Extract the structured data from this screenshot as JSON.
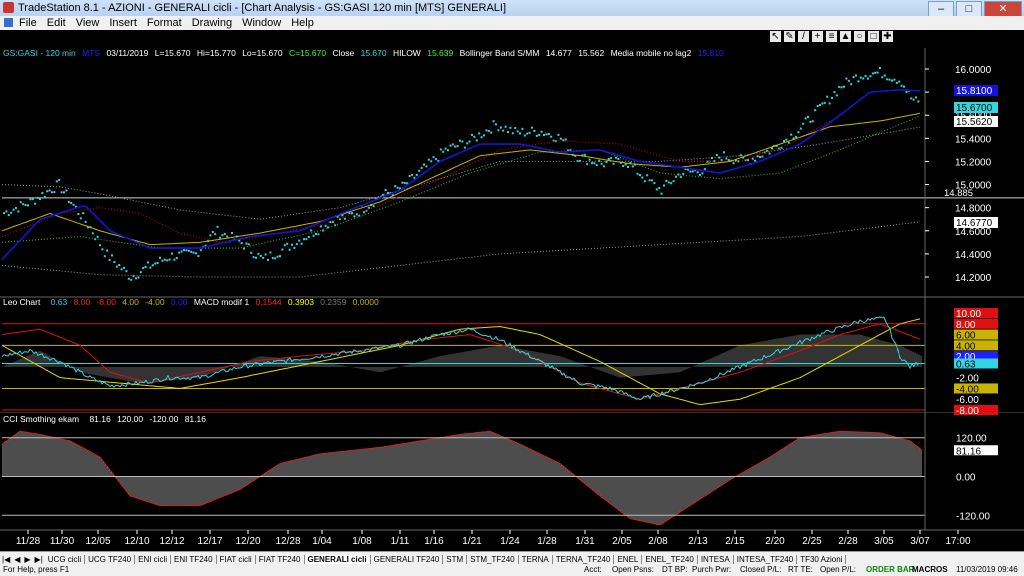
{
  "window": {
    "title": "TradeStation 8.1 - AZIONI - GENERALI cicli - [Chart Analysis - GS:GASI  120 min  [MTS] GENERALI]"
  },
  "menu": [
    "File",
    "Edit",
    "View",
    "Insert",
    "Format",
    "Drawing",
    "Window",
    "Help"
  ],
  "price_header": {
    "symbol": "GS:GASI - 120 min",
    "mts": "MTS",
    "date": "03/11/2019",
    "open": "L=15.670",
    "high": "Hi=15.770",
    "low": "Lo=15.670",
    "close": "C=15.670",
    "close_label": "Close",
    "close_val": "15.670",
    "hilow_label": "HILOW",
    "hilow_val": "15.639",
    "bb_label": "Bollinger Band S/MM",
    "bb_val1": "14.677",
    "bb_val2": "15.562",
    "mm_label": "Media mobile no lag2",
    "mm_val": "15.810"
  },
  "leo_header": {
    "label": "Leo Chart",
    "v1": "0.63",
    "v2": "8.00",
    "v3": "-8.00",
    "v4": "4.00",
    "v5": "-4.00",
    "v6": "0.00",
    "macd_label": "MACD modif 1",
    "m1": "0.1544",
    "m2": "0.3903",
    "m3": "0.2359",
    "m4": "0.0000"
  },
  "cci_header": {
    "label": "CCI Smothing ekam",
    "v1": "81.16",
    "v2": "120.00",
    "v3": "-120.00",
    "v4": "81.16"
  },
  "price_axis": [
    "16.0000",
    "15.8000",
    "15.6000",
    "15.4000",
    "15.2000",
    "15.0000",
    "14.8000",
    "14.6000",
    "14.4000",
    "14.2000"
  ],
  "price_tags": [
    {
      "text": "15.8100",
      "bg": "#1414d8",
      "fg": "#ffffff"
    },
    {
      "text": "15.6700",
      "bg": "#33d6e0",
      "fg": "#000000"
    },
    {
      "text": "15.5620",
      "bg": "#ffffff",
      "fg": "#000000"
    },
    {
      "text": "14.6770",
      "bg": "#ffffff",
      "fg": "#000000"
    }
  ],
  "price_line_label": "14.885",
  "leo_axis": [
    "10.00",
    "8.00",
    "6.00",
    "4.00",
    "2.00",
    "0.63",
    "-2.00",
    "-4.00",
    "-6.00",
    "-8.00"
  ],
  "cci_axis": [
    "120.00",
    "81.16",
    "0.00",
    "-120.00"
  ],
  "x_axis": [
    "11/28",
    "11/30",
    "12/05",
    "12/10",
    "12/12",
    "12/17",
    "12/20",
    "12/28",
    "1/04",
    "1/08",
    "1/11",
    "1/16",
    "1/21",
    "1/24",
    "1/28",
    "1/31",
    "2/05",
    "2/08",
    "2/13",
    "2/15",
    "2/20",
    "2/25",
    "2/28",
    "3/05",
    "3/07",
    "17:00"
  ],
  "tabs": [
    "UCG cicli",
    "UCG TF240",
    "ENI cicli",
    "ENI TF240",
    "FIAT cicli",
    "FIAT TF240",
    "GENERALI cicli",
    "GENERALI TF240",
    "STM",
    "STM_TF240",
    "TERNA",
    "TERNA_TF240",
    "ENEL",
    "ENEL_TF240",
    "INTESA",
    "INTESA_TF240",
    "TF30 Azioni"
  ],
  "active_tab": "GENERALI cicli",
  "status": {
    "help": "For Help, press F1",
    "acct": "Acct:",
    "open_psns": "Open Psns:",
    "dt_bp": "DT BP:",
    "purch_pwr": "Purch Pwr:",
    "closed_pl": "Closed P/L:",
    "rt_te": "RT TE:",
    "open_pl": "Open P/L:",
    "order_bar": "ORDER BAR",
    "macros": "MACROS",
    "datetime": "11/03/2019 09:46"
  },
  "colors": {
    "price": "#33d6e0",
    "blue_ma": "#1414d8",
    "bb_mid": "#c8b400",
    "red_dot": "#c00000",
    "green_dot": "#22b422",
    "grey_dot": "#9a9a9a",
    "red_line": "#e01010",
    "yellow": "#e8d800"
  }
}
